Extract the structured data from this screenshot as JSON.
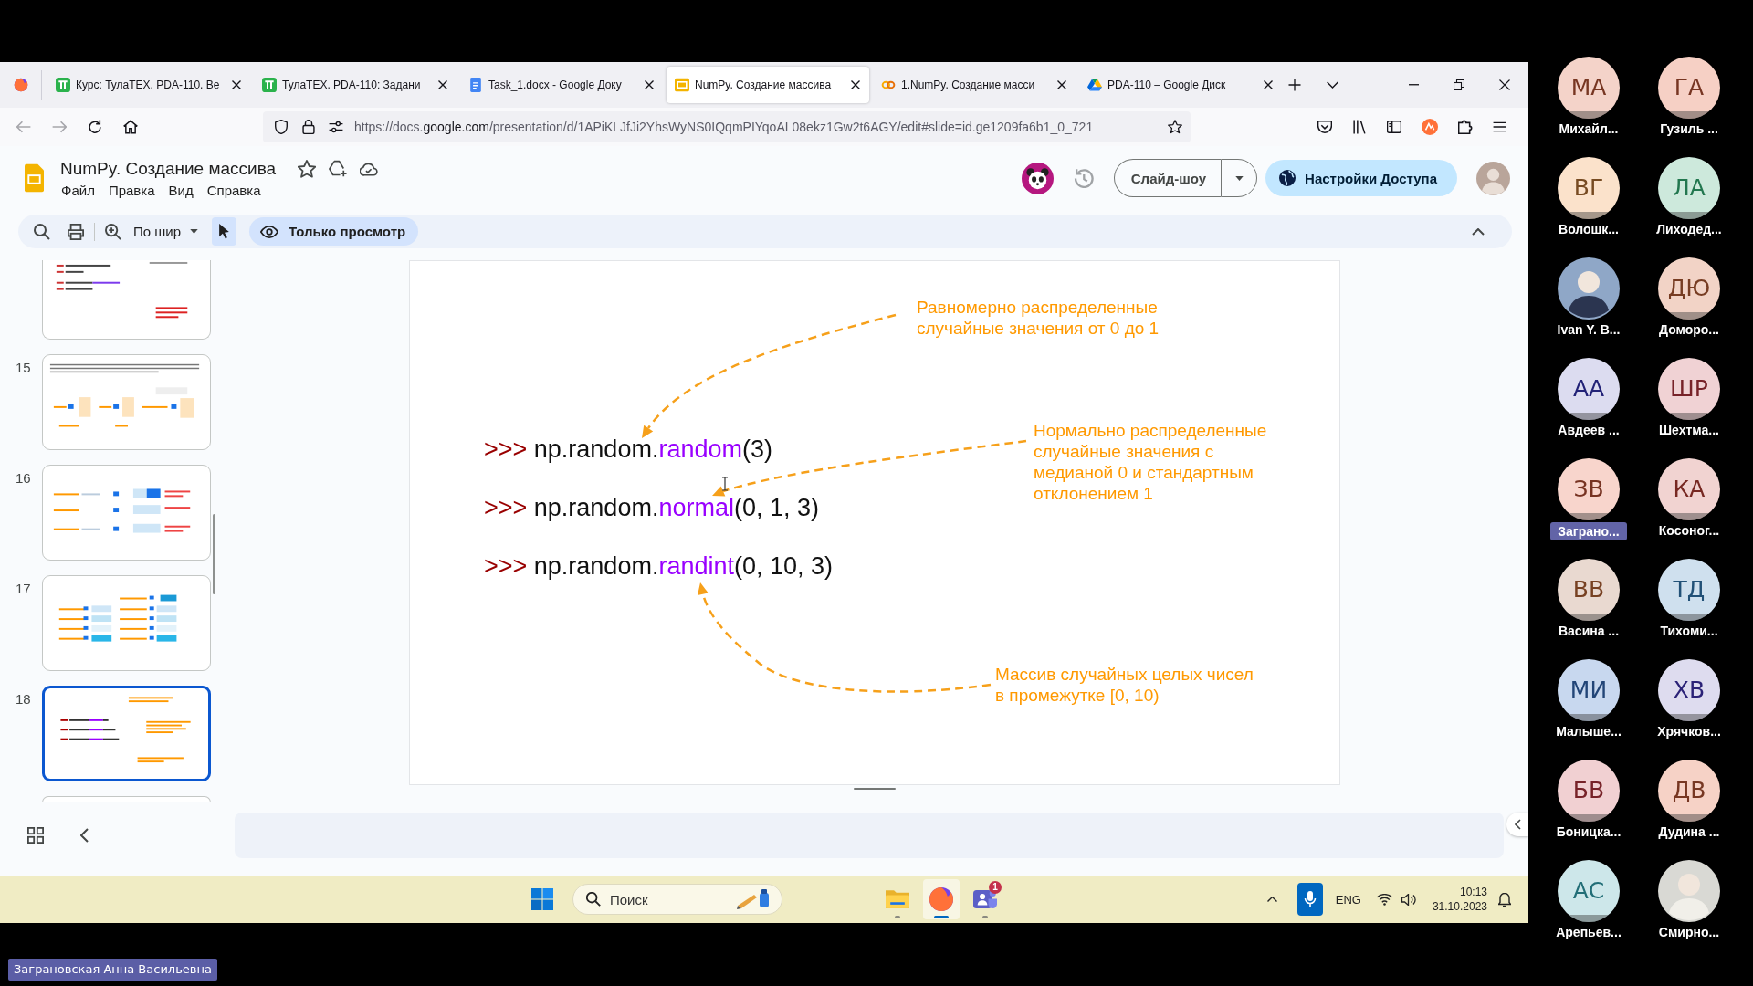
{
  "browser": {
    "tabs": [
      {
        "kind": "tt",
        "label": "Курс: ТулаТЕХ. PDA-110. Ве",
        "selected": false
      },
      {
        "kind": "tt",
        "label": "ТулаТЕХ. PDA-110: Задани",
        "selected": false
      },
      {
        "kind": "docs",
        "label": "Task_1.docx - Google Доку",
        "selected": false
      },
      {
        "kind": "slides",
        "label": "NumPy. Создание массива",
        "selected": true
      },
      {
        "kind": "colab",
        "label": "1.NumPy. Создание масси",
        "selected": false
      },
      {
        "kind": "drive",
        "label": "PDA-110 – Google Диск",
        "selected": false
      }
    ],
    "url": {
      "prefix": "https://docs.",
      "domain": "google.com",
      "path": "/presentation/d/1APiKLJfJi2YhsWyNS0IQqmPIYqoAL08ekz1Gw2t6AGY/edit#slide=id.ge1209fa6b1_0_721"
    }
  },
  "document": {
    "title": "NumPy. Создание массива",
    "menu": [
      "Файл",
      "Правка",
      "Вид",
      "Справка"
    ],
    "slideshow": "Слайд-шоу",
    "share": "Настройки Доступа"
  },
  "toolbar": {
    "zoom": "По шир",
    "pointer_selected": true,
    "mode": "Только просмотр"
  },
  "thumbnails": [
    {
      "selected": false
    },
    {
      "number": "15",
      "selected": false
    },
    {
      "number": "16",
      "selected": false
    },
    {
      "number": "17",
      "selected": false
    },
    {
      "number": "18",
      "selected": true
    },
    {
      "selected": false
    }
  ],
  "slide": {
    "code": [
      {
        "prompt": ">>>",
        "object": "np.random.",
        "function": "random",
        "args": "(3)"
      },
      {
        "prompt": ">>>",
        "object": "np.random.",
        "function": "normal",
        "args": "(0, 1, 3)"
      },
      {
        "prompt": ">>>",
        "object": "np.random.",
        "function": "randint",
        "args": "(0, 10, 3)"
      }
    ],
    "annotations": [
      "Равномерно распределенные\nслучайные значения от 0 до 1",
      "Нормально распределенные\nслучайные значения с\nмедианой 0 и стандартным\nотклонением 1",
      "Массив случайных целых чисел\nв промежутке [0, 10)"
    ]
  },
  "taskbar": {
    "search": {
      "placeholder": "Поиск"
    },
    "apps": [
      {
        "kind": "explorer",
        "active": false
      },
      {
        "kind": "firefox",
        "active": true
      },
      {
        "kind": "teams",
        "active": false,
        "badge": "1"
      }
    ],
    "language": "ENG",
    "time": "10:13",
    "date": "31.10.2023"
  },
  "participant_rows": [
    [
      {
        "kind": "initials",
        "initials": "МА",
        "name": "Михайл...",
        "color": "#f4d3c9",
        "active": false
      },
      {
        "kind": "initials",
        "initials": "ГА",
        "name": "Гузиль ...",
        "color": "#f6d0c5",
        "active": false
      }
    ],
    [
      {
        "kind": "initials",
        "initials": "ВГ",
        "name": "Волошк...",
        "color": "#fbe2cb",
        "active": false
      },
      {
        "kind": "initials",
        "initials": "ЛА",
        "name": "Лиходед...",
        "color": "#cde9dc",
        "active": false
      }
    ],
    [
      {
        "kind": "photo",
        "name": "Ivan Y. B...",
        "active": false
      },
      {
        "kind": "initials",
        "initials": "ДЮ",
        "name": "Доморо...",
        "color": "#f2d3c6",
        "active": false
      }
    ],
    [
      {
        "kind": "initials",
        "initials": "АА",
        "name": "Авдеев ...",
        "color": "#dcdcf0",
        "active": false
      },
      {
        "kind": "initials",
        "initials": "ШР",
        "name": "Шехтма...",
        "color": "#f0d2d4",
        "active": false
      }
    ],
    [
      {
        "kind": "initials",
        "initials": "ЗВ",
        "name": "Заграно...",
        "color": "#f8d5cc",
        "active": true
      },
      {
        "kind": "initials",
        "initials": "КА",
        "name": "Косоног...",
        "color": "#f1d3d1",
        "active": false
      }
    ],
    [
      {
        "kind": "initials",
        "initials": "ВВ",
        "name": "Васина ...",
        "color": "#e9d9d0",
        "active": false
      },
      {
        "kind": "initials",
        "initials": "ТД",
        "name": "Тихоми...",
        "color": "#cfe0ee",
        "active": false
      }
    ],
    [
      {
        "kind": "initials",
        "initials": "МИ",
        "name": "Малыше...",
        "color": "#c8d8ef",
        "active": false
      },
      {
        "kind": "initials",
        "initials": "ХВ",
        "name": "Хрячков...",
        "color": "#dedcef",
        "active": false
      }
    ],
    [
      {
        "kind": "initials",
        "initials": "БВ",
        "name": "Боницка...",
        "color": "#f1d0d2",
        "active": false
      },
      {
        "kind": "initials",
        "initials": "ДВ",
        "name": "Дудина ...",
        "color": "#f6d2c6",
        "active": false
      }
    ],
    [
      {
        "kind": "initials",
        "initials": "АС",
        "name": "Арепьев...",
        "color": "#cde7ea",
        "active": false
      },
      {
        "kind": "photo",
        "name": "Смирно...",
        "active": false
      }
    ]
  ],
  "presenter": "Заграновская Анна Васильевна"
}
